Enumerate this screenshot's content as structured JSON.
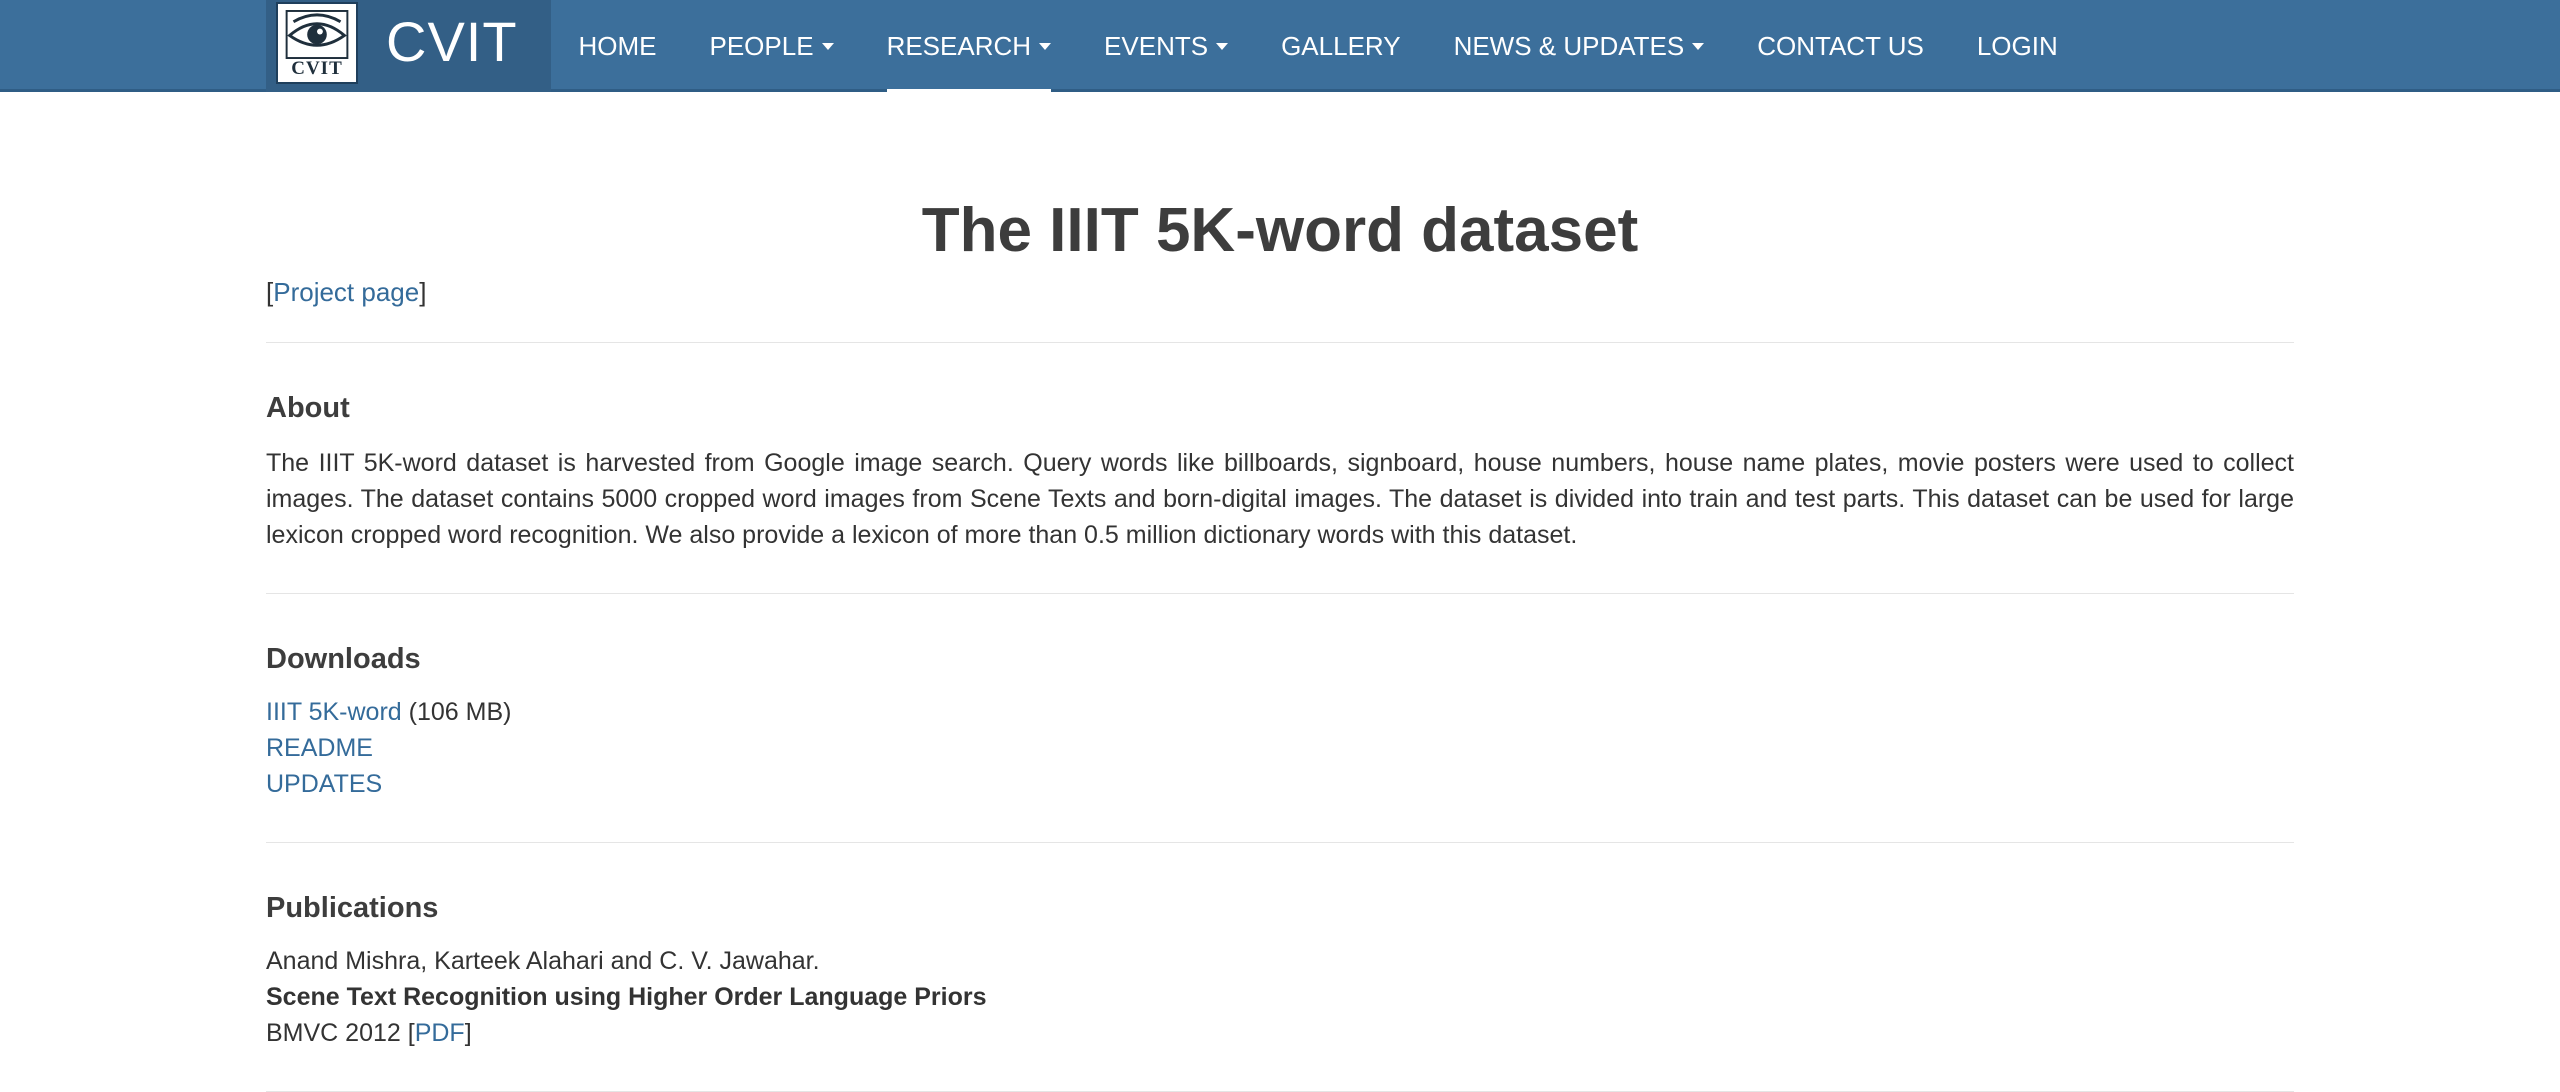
{
  "brand": {
    "logo_text": "CVIT",
    "name": "CVIT"
  },
  "nav": {
    "items": [
      {
        "label": "HOME",
        "dropdown": false,
        "active": false
      },
      {
        "label": "PEOPLE",
        "dropdown": true,
        "active": false
      },
      {
        "label": "RESEARCH",
        "dropdown": true,
        "active": true
      },
      {
        "label": "EVENTS",
        "dropdown": true,
        "active": false
      },
      {
        "label": "GALLERY",
        "dropdown": false,
        "active": false
      },
      {
        "label": "NEWS & UPDATES",
        "dropdown": true,
        "active": false
      },
      {
        "label": "CONTACT US",
        "dropdown": false,
        "active": false
      },
      {
        "label": "LOGIN",
        "dropdown": false,
        "active": false
      }
    ]
  },
  "page": {
    "title": "The IIIT 5K-word dataset",
    "project_link": "Project page"
  },
  "about": {
    "heading": "About",
    "text": "The IIIT 5K-word dataset is harvested from Google image search. Query words like billboards, signboard, house numbers, house name plates, movie posters were used to collect images. The dataset contains 5000 cropped word images from Scene Texts and born-digital images. The dataset is divided into train and test parts. This dataset can be used for large lexicon cropped word recognition. We also provide a lexicon of more than 0.5 million dictionary words with this dataset."
  },
  "downloads": {
    "heading": "Downloads",
    "dataset_link": "IIIT 5K-word",
    "dataset_size": "(106 MB)",
    "readme_link": "README",
    "updates_link": "UPDATES"
  },
  "publications": {
    "heading": "Publications",
    "authors": "Anand Mishra, Karteek Alahari and C. V. Jawahar.",
    "title": "Scene Text Recognition using Higher Order Language Priors",
    "venue": "BMVC 2012",
    "pdf_link": "PDF"
  },
  "colors": {
    "navbar": "#3c6f9b",
    "brand_bg": "#335f86",
    "link": "#346b9a",
    "heading": "#3d3d3d"
  }
}
